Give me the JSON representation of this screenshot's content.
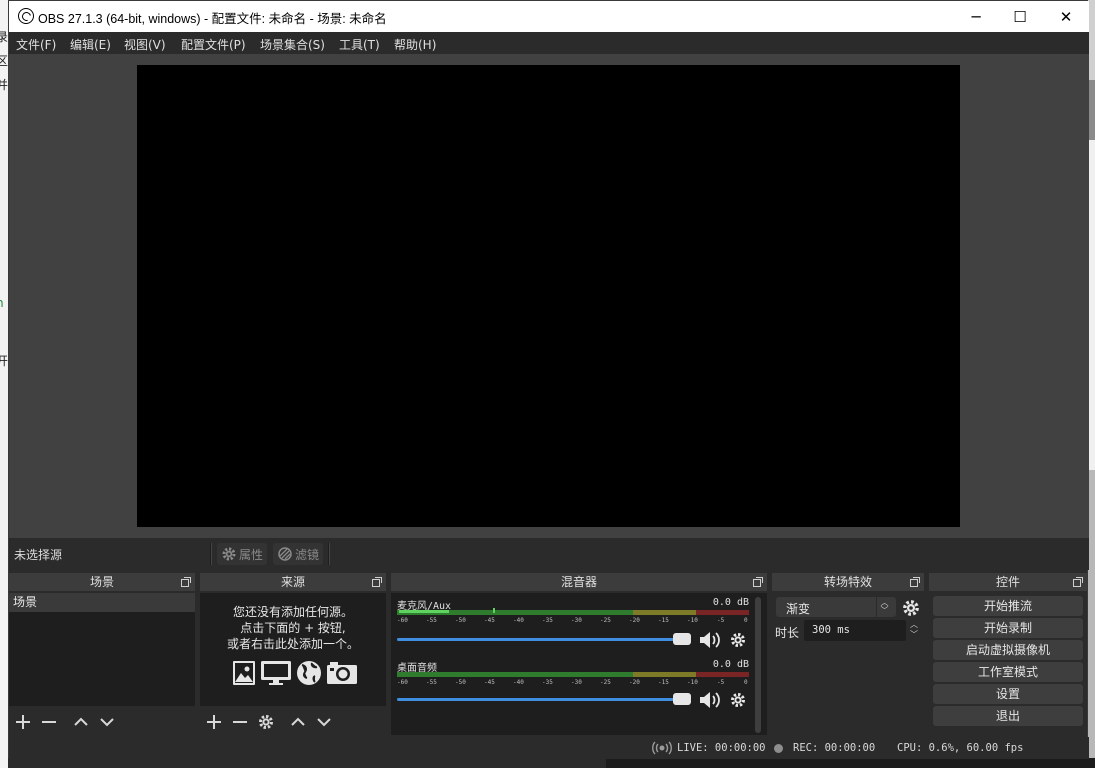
{
  "window": {
    "title": "OBS 27.1.3 (64-bit, windows) - 配置文件: 未命名 - 场景: 未命名",
    "minimize_glyph": "─",
    "maximize_glyph": "☐",
    "close_glyph": "✕"
  },
  "menu": [
    "文件(F)",
    "编辑(E)",
    "视图(V)",
    "配置文件(P)",
    "场景集合(S)",
    "工具(T)",
    "帮助(H)"
  ],
  "source_toolbar": {
    "status": "未选择源",
    "properties_label": "属性",
    "filters_label": "滤镜"
  },
  "docks": {
    "scenes": {
      "title": "场景",
      "items": [
        "场景"
      ]
    },
    "sources": {
      "title": "来源",
      "empty_lines": [
        "您还没有添加任何源。",
        "点击下面的 + 按钮,",
        "或者右击此处添加一个。"
      ]
    },
    "mixer": {
      "title": "混音器",
      "channels": [
        {
          "name": "麦克风/Aux",
          "db": "0.0 dB",
          "level": 0.09
        },
        {
          "name": "桌面音频",
          "db": "0.0 dB",
          "level": 0.0
        }
      ],
      "scale": [
        "-60",
        "-55",
        "-50",
        "-45",
        "-40",
        "-35",
        "-30",
        "-25",
        "-20",
        "-15",
        "-10",
        "-5",
        "0"
      ]
    },
    "transitions": {
      "title": "转场特效",
      "selected": "渐变",
      "duration_label": "时长",
      "duration_value": "300 ms"
    },
    "controls": {
      "title": "控件",
      "buttons": [
        "开始推流",
        "开始录制",
        "启动虚拟摄像机",
        "工作室模式",
        "设置",
        "退出"
      ]
    }
  },
  "status": {
    "live": "LIVE: 00:00:00",
    "rec": "REC: 00:00:00",
    "cpu": "CPU: 0.6%, 60.00 fps"
  },
  "colors": {
    "accent": "#3f8ee0",
    "meter_green": "#2f7c2f",
    "meter_yellow": "#7d7a28",
    "meter_red": "#7a2525"
  }
}
